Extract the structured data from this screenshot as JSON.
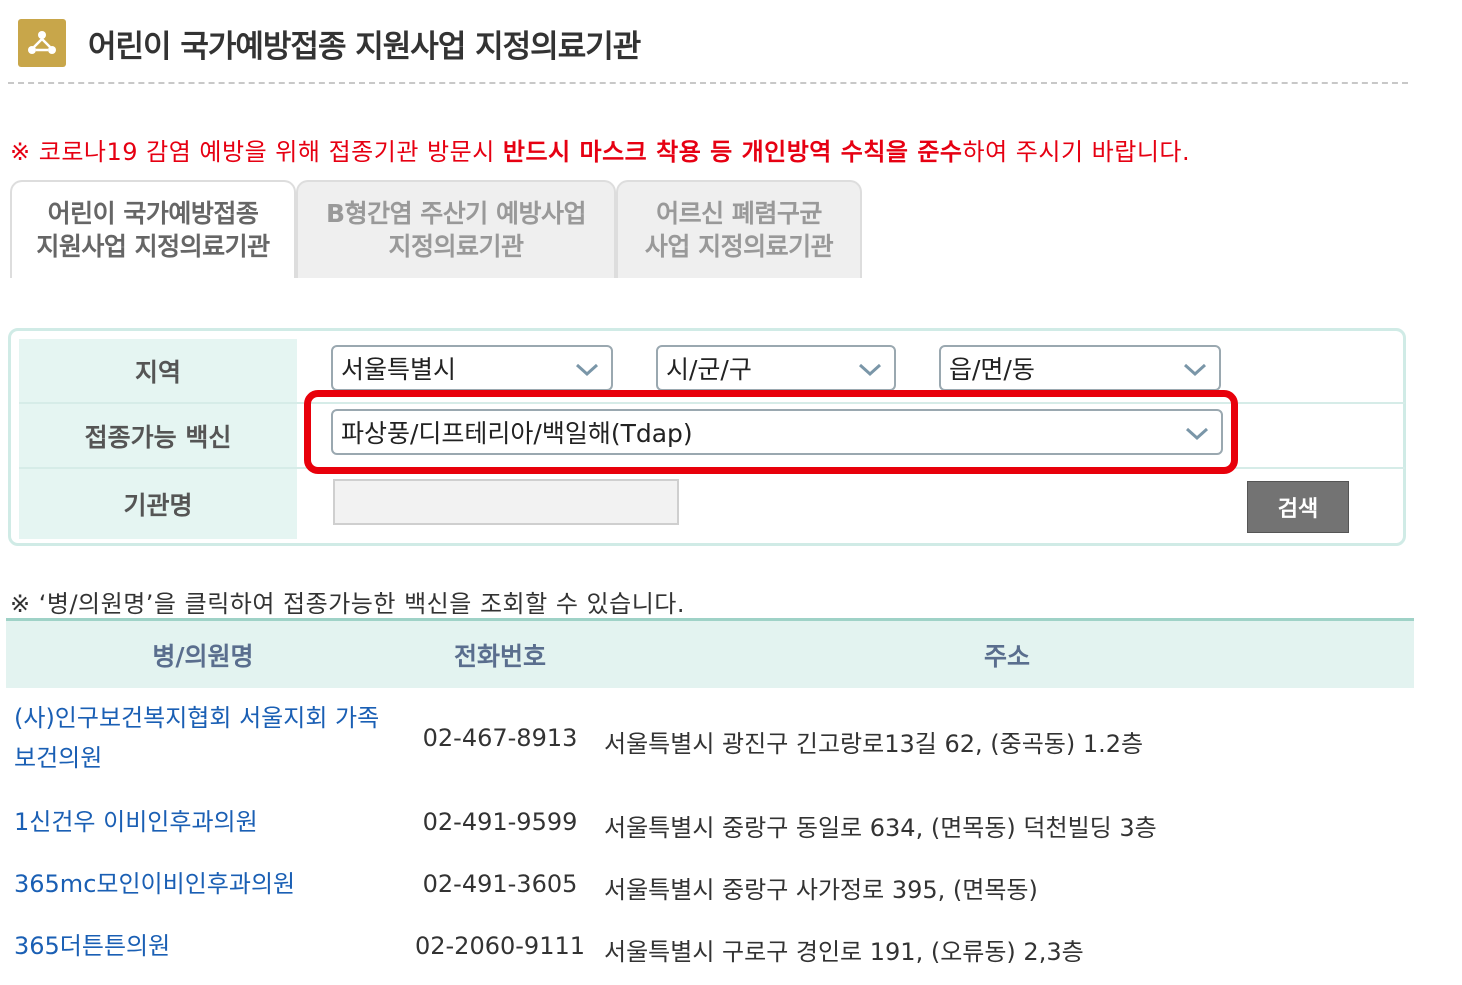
{
  "header": {
    "title": "어린이 국가예방접종 지원사업 지정의료기관",
    "icon": "people-icon",
    "accent_color": "#c8a64a"
  },
  "notice": {
    "part1": "※ 코로나19 감염 예방을 위해 접종기관 방문시 ",
    "bold1": "반드시 마스크 착용 등 개인방역 수칙을 준수",
    "part2": "하여 주시기 바랍니다.",
    "color": "#e60012"
  },
  "tabs": [
    {
      "line1": "어린이 국가예방접종",
      "line2": "지원사업 지정의료기관",
      "active": true
    },
    {
      "line1": "B형간염 주산기 예방사업",
      "line2": "지정의료기관",
      "active": false
    },
    {
      "line1": "어르신 폐렴구균",
      "line2": "사업 지정의료기관",
      "active": false
    }
  ],
  "search_form": {
    "region_label": "지역",
    "region_select_1": "서울특별시",
    "region_select_2": "시/군/구",
    "region_select_3": "읍/면/동",
    "vaccine_label": "접종가능 백신",
    "vaccine_select": "파상풍/디프테리아/백일해(Tdap)",
    "institution_label": "기관명",
    "institution_value": "",
    "search_button": "검색"
  },
  "hint": "※ ‘병/의원명’을 클릭하여 접종가능한 백신을 조회할 수 있습니다.",
  "results": {
    "headers": {
      "name": "병/의원명",
      "phone": "전화번호",
      "address": "주소"
    },
    "rows": [
      {
        "name": "(사)인구보건복지협회 서울지회 가족보건의원",
        "phone": "02-467-8913",
        "address": "서울특별시 광진구 긴고랑로13길 62, (중곡동) 1.2층"
      },
      {
        "name": "1신건우 이비인후과의원",
        "phone": "02-491-9599",
        "address": "서울특별시 중랑구 동일로 634, (면목동) 덕천빌딩 3층"
      },
      {
        "name": "365mc모인이비인후과의원",
        "phone": "02-491-3605",
        "address": "서울특별시 중랑구 사가정로 395, (면목동)"
      },
      {
        "name": "365더튼튼의원",
        "phone": "02-2060-9111",
        "address": "서울특별시 구로구 경인로 191, (오류동) 2,3층"
      }
    ]
  }
}
